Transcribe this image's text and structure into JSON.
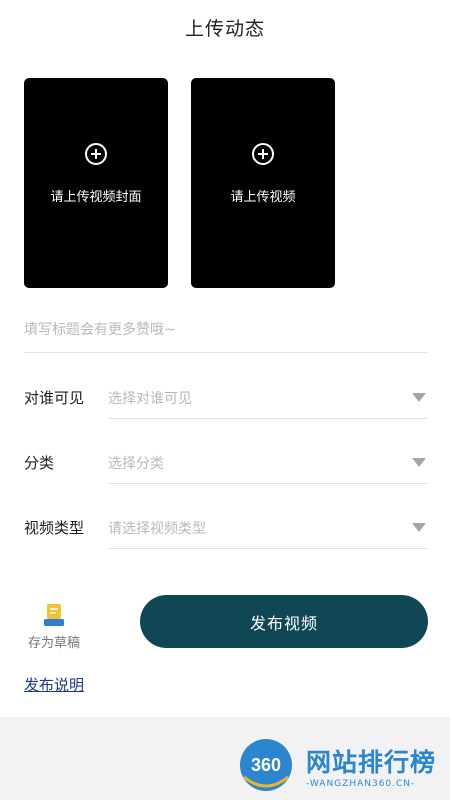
{
  "header": {
    "title": "上传动态"
  },
  "uploads": {
    "cover": {
      "label": "请上传视频封面",
      "icon": "plus-circle-icon"
    },
    "video": {
      "label": "请上传视频",
      "icon": "plus-circle-icon"
    }
  },
  "title_input": {
    "placeholder": "填写标题会有更多赞哦~",
    "value": ""
  },
  "form": {
    "visibility": {
      "label": "对谁可见",
      "placeholder": "选择对谁可见",
      "icon": "caret-down-icon"
    },
    "category": {
      "label": "分类",
      "placeholder": "选择分类",
      "icon": "caret-down-icon"
    },
    "video_type": {
      "label": "视频类型",
      "placeholder": "请选择视频类型",
      "icon": "caret-down-icon"
    }
  },
  "actions": {
    "draft_label": "存为草稿",
    "draft_icon": "draft-document-icon",
    "publish_label": "发布视频"
  },
  "links": {
    "publish_notes": "发布说明"
  },
  "watermark": {
    "logo_text": "360",
    "title": "网站排行榜",
    "subtitle": "-WANGZHAN360.CN-"
  },
  "colors": {
    "primary_button": "#0f4854",
    "upload_box": "#000000",
    "link": "#1d3a8a",
    "placeholder": "#b9b9b9",
    "draft_icon_yellow": "#f5c12e",
    "draft_icon_blue": "#2f7fd1",
    "watermark_blue": "#2c86cf"
  }
}
